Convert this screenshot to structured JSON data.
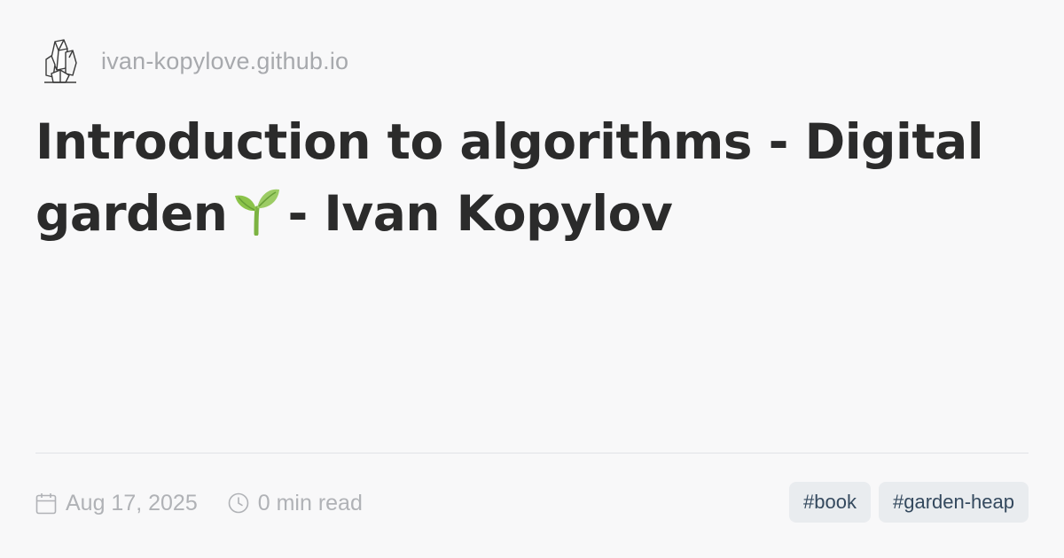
{
  "site": {
    "logo_icon": "crystal-logo-icon",
    "domain": "ivan-kopylove.github.io"
  },
  "title": {
    "line1": "Introduction to algorithms - Digital",
    "line2_start": "garden",
    "line2_emoji": "seedling-icon",
    "line2_end": "- Ivan Kopylov"
  },
  "meta": {
    "date_icon": "calendar-icon",
    "date": "Aug 17, 2025",
    "read_icon": "clock-icon",
    "read_time": "0 min read"
  },
  "tags": [
    "#book",
    "#garden-heap"
  ],
  "colors": {
    "background": "#f8f8f9",
    "title": "#2b2b2b",
    "muted": "#b0b2b6",
    "tag_bg": "#e9ecef",
    "tag_text": "#34495e",
    "sprout_green": "#8bc34a"
  }
}
